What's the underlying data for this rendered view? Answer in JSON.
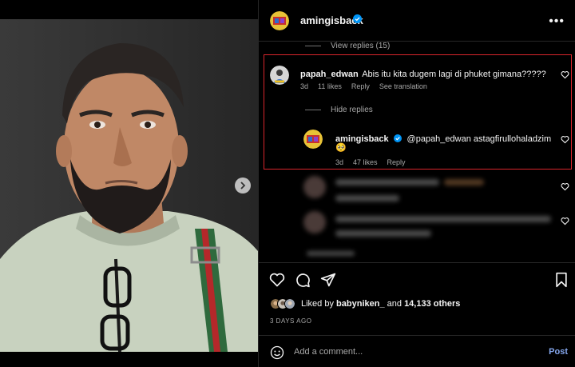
{
  "post": {
    "username": "amingisback",
    "verified": true
  },
  "comments": {
    "view_replies": "View replies (15)",
    "hide_replies": "Hide replies",
    "main": {
      "username": "papah_edwan",
      "text": "Abis itu kita dugem lagi di phuket gimana?????",
      "age": "3d",
      "likes": "11 likes",
      "reply": "Reply",
      "translate": "See translation"
    },
    "reply": {
      "username": "amingisback",
      "text": "@papah_edwan astagfirullohaladzim",
      "emoji": "🥺",
      "age": "3d",
      "likes": "47 likes",
      "reply": "Reply"
    }
  },
  "likes": {
    "prefix": "Liked by",
    "first_user": "babyniken_",
    "connector": "and",
    "others": "14,133 others"
  },
  "date": "3 DAYS AGO",
  "add_comment": {
    "placeholder": "Add a comment...",
    "post_label": "Post"
  },
  "icons": [
    "heart-icon",
    "comment-icon",
    "share-icon",
    "bookmark-icon",
    "emoji-icon",
    "verified-icon",
    "chevron-right-icon",
    "more-icon"
  ],
  "colors": {
    "background": "#000000",
    "highlight": "#d9262c",
    "verified": "#0095f6",
    "post_button": "#85a7ee",
    "secondary_text": "#a8a8a8"
  }
}
